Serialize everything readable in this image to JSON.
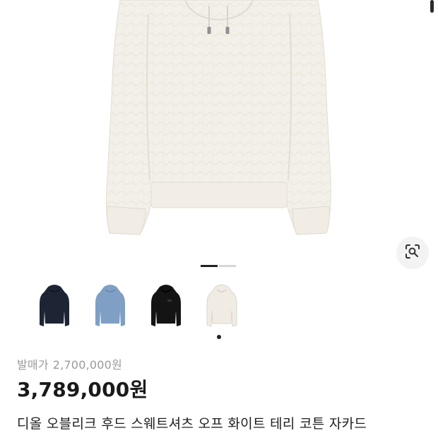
{
  "product": {
    "list_price_label": "발매가",
    "list_price": "2,700,000원",
    "sale_price": "3,789,000원",
    "name": "디올 오블리크 후드 스웨트셔츠 오프 화이트 테리 코튼 자카드"
  },
  "gallery": {
    "total_images": 2,
    "current_image": 1
  },
  "color_options": [
    {
      "name": "navy",
      "color": "#1d2535"
    },
    {
      "name": "light-blue",
      "color": "#7f9fc4"
    },
    {
      "name": "black",
      "color": "#141414"
    },
    {
      "name": "off-white",
      "color": "#f0ece4",
      "selected": true
    }
  ],
  "icons": {
    "lens_button": "visual-search-icon"
  }
}
